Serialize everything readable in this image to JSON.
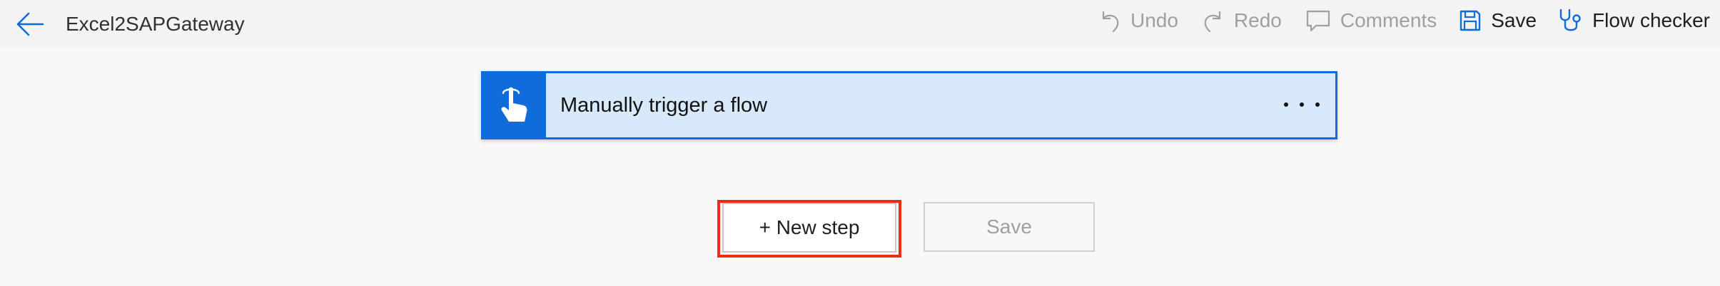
{
  "header": {
    "title": "Excel2SAPGateway",
    "toolbar": {
      "undo_label": "Undo",
      "redo_label": "Redo",
      "comments_label": "Comments",
      "save_label": "Save",
      "flow_checker_label": "Flow checker"
    }
  },
  "trigger": {
    "title": "Manually trigger a flow",
    "icon": "hand-touch-icon"
  },
  "actions": {
    "new_step_label": "+ New step",
    "save_label": "Save"
  },
  "colors": {
    "accent": "#0f6cda",
    "card_bg": "#d8e9fb",
    "highlight": "#ea2e12",
    "disabled_text": "#a19f9d"
  }
}
